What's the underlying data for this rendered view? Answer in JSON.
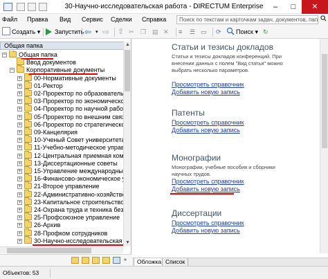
{
  "window": {
    "title": "30-Научно-исследовательская работа - DIRECTUM Enterprise",
    "minimize": "–",
    "maximize": "□",
    "close": "✕"
  },
  "menu": {
    "items": [
      "Файл",
      "Правка",
      "Вид",
      "Сервис",
      "Сделки",
      "Справка"
    ],
    "search_placeholder": "Поиск по текстам и карточкам задач, документов, папок"
  },
  "toolbar": {
    "create_label": "Создать",
    "run_label": "Запустить",
    "search_label": "Поиск"
  },
  "left_pane": {
    "header": "Общая папка",
    "close": "×",
    "tree": [
      {
        "label": "Общая папка",
        "level": 0,
        "expanded": true,
        "highlight": true
      },
      {
        "label": "Ввод документов",
        "level": 1,
        "expanded": null,
        "highlight": false
      },
      {
        "label": "Корпоративные документы",
        "level": 1,
        "expanded": true,
        "highlight": true
      },
      {
        "label": "00-Нормативные документы",
        "level": 2,
        "expanded": false,
        "highlight": false
      },
      {
        "label": "01-Ректор",
        "level": 2,
        "expanded": false,
        "highlight": false
      },
      {
        "label": "02-Проректор по образовательной деят",
        "level": 2,
        "expanded": false,
        "highlight": false
      },
      {
        "label": "03-Проректор по экономической деят",
        "level": 2,
        "expanded": false,
        "highlight": false
      },
      {
        "label": "04-Проректор по научной работе",
        "level": 2,
        "expanded": false,
        "highlight": false
      },
      {
        "label": "05-Проректор по внешним связям",
        "level": 2,
        "expanded": false,
        "highlight": false
      },
      {
        "label": "06-Проректор по стратегическому раз",
        "level": 2,
        "expanded": false,
        "highlight": false
      },
      {
        "label": "09-Канцелярия",
        "level": 2,
        "expanded": false,
        "highlight": false
      },
      {
        "label": "10-Ученый Совет университета",
        "level": 2,
        "expanded": false,
        "highlight": false
      },
      {
        "label": "11-Учебно-методическое управление",
        "level": 2,
        "expanded": false,
        "highlight": false
      },
      {
        "label": "12-Центральная приемная комиссия",
        "level": 2,
        "expanded": false,
        "highlight": false
      },
      {
        "label": "13-Диссертационные советы",
        "level": 2,
        "expanded": false,
        "highlight": false
      },
      {
        "label": "15-Управление международных связей",
        "level": 2,
        "expanded": false,
        "highlight": false
      },
      {
        "label": "16-Финансово-экономическое управлен",
        "level": 2,
        "expanded": false,
        "highlight": false
      },
      {
        "label": "21-Второе управление",
        "level": 2,
        "expanded": false,
        "highlight": false
      },
      {
        "label": "22-Административно-хозяйственная ч",
        "level": 2,
        "expanded": false,
        "highlight": false
      },
      {
        "label": "23-Капитальное строительство",
        "level": 2,
        "expanded": false,
        "highlight": false
      },
      {
        "label": "24-Охрана труда и техника безопаснос",
        "level": 2,
        "expanded": false,
        "highlight": false
      },
      {
        "label": "25-Профсоюзное управление",
        "level": 2,
        "expanded": false,
        "highlight": false
      },
      {
        "label": "26-Архив",
        "level": 2,
        "expanded": false,
        "highlight": false
      },
      {
        "label": "28-Профком сотрудников",
        "level": 2,
        "expanded": false,
        "highlight": false
      },
      {
        "label": "30-Научно-исследовательская работа",
        "level": 2,
        "expanded": false,
        "highlight": true
      }
    ]
  },
  "right_pane": {
    "sections": [
      {
        "title": "Статьи и тезисы докладов",
        "description": "Статьи и тезисы докладов конференций. При внесении данных с полем \"Вид статьи\" можно выбрать несколько параметров.",
        "links": [
          "Просмотреть справочник",
          "Добавить новую запись"
        ],
        "highlight_link": null
      },
      {
        "title": "Патенты",
        "description": "",
        "links": [
          "Просмотреть справочник",
          "Добавить новую запись"
        ],
        "highlight_link": null
      },
      {
        "title": "Монографии",
        "description": "Монографии, учебные пособия и сборники научных трудов.",
        "links": [
          "Просмотреть справочник",
          "Добавить новую запись"
        ],
        "highlight_link": 1
      },
      {
        "title": "Диссертации",
        "description": "",
        "links": [
          "Просмотреть справочник",
          "Добавить новую запись"
        ],
        "highlight_link": null
      }
    ],
    "tabs": [
      "Обложка",
      "Список"
    ],
    "active_tab": 0
  },
  "status": {
    "objects": "Объектов: 53"
  },
  "colors": {
    "highlight_underline": "#d80000",
    "link": "#1a3fb0",
    "section_title": "#3f5466",
    "folder": "#f4d46a"
  }
}
